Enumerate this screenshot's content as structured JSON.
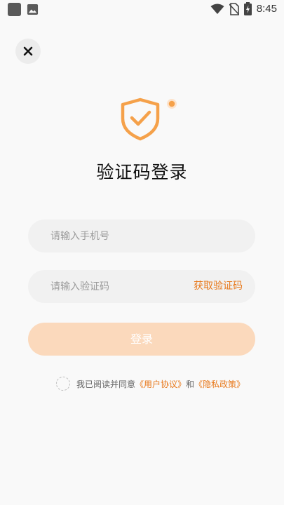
{
  "status_bar": {
    "time": "8:45",
    "icons": [
      "notification-square-icon",
      "image-icon",
      "wifi-icon",
      "no-sim-icon",
      "battery-charging-icon"
    ]
  },
  "header": {
    "close_icon": "close-icon"
  },
  "hero": {
    "icon": "shield-check-icon",
    "accent_color": "#f5a14a",
    "title": "验证码登录"
  },
  "form": {
    "phone": {
      "value": "",
      "placeholder": "请输入手机号"
    },
    "code": {
      "value": "",
      "placeholder": "请输入验证码",
      "action_label": "获取验证码"
    },
    "login_button": "登录"
  },
  "agreement": {
    "checked": false,
    "prefix": "我已阅读并同意",
    "user_agreement": "《用户协议》",
    "conjunction": "和",
    "privacy_policy": "《隐私政策》"
  },
  "colors": {
    "accent": "#e8781a",
    "button_disabled": "#fbd9bc",
    "field_bg": "#f1f1f1",
    "page_bg": "#f9f9f9"
  }
}
